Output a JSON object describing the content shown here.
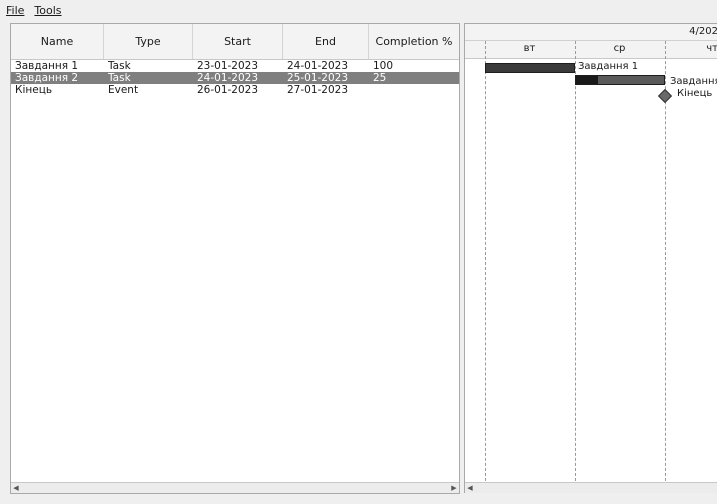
{
  "menu": {
    "file": "File",
    "tools": "Tools"
  },
  "table": {
    "columns": [
      "Name",
      "Type",
      "Start",
      "End",
      "Completion %"
    ],
    "rows": [
      {
        "name": "Завдання 1",
        "type": "Task",
        "start": "23-01-2023",
        "end": "24-01-2023",
        "completion": "100",
        "selected": false
      },
      {
        "name": "Завдання 2",
        "type": "Task",
        "start": "24-01-2023",
        "end": "25-01-2023",
        "completion": "25",
        "selected": true
      },
      {
        "name": "Кінець",
        "type": "Event",
        "start": "26-01-2023",
        "end": "27-01-2023",
        "completion": "",
        "selected": false
      }
    ]
  },
  "gantt": {
    "header_period": "4/202",
    "days": [
      "вт",
      "ср",
      "чт"
    ],
    "bar_labels": [
      "Завдання 1",
      "Завдання",
      "Кінець"
    ],
    "task2_progress": 0.25
  },
  "icons": {
    "scroll_left": "arrow-left-icon",
    "scroll_right": "arrow-right-icon",
    "milestone": "diamond-icon"
  }
}
